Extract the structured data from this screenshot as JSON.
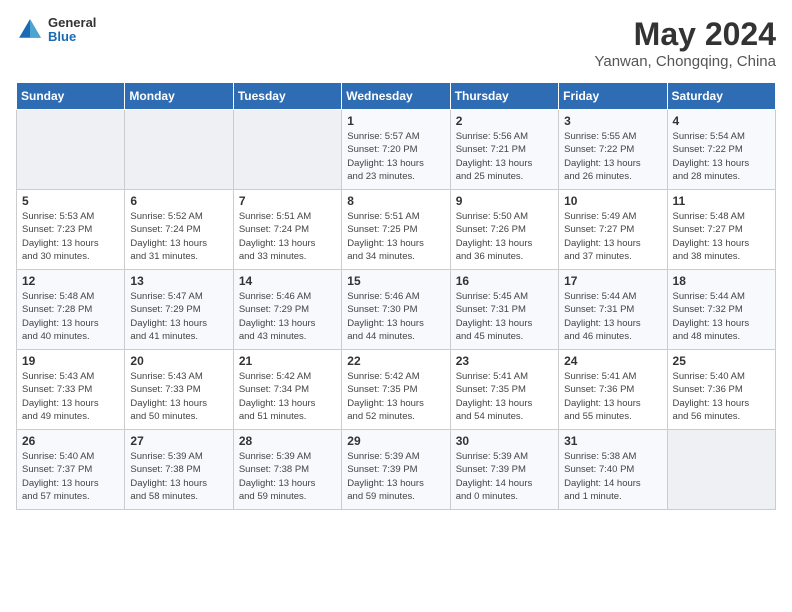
{
  "header": {
    "logo_general": "General",
    "logo_blue": "Blue",
    "title": "May 2024",
    "subtitle": "Yanwan, Chongqing, China"
  },
  "weekdays": [
    "Sunday",
    "Monday",
    "Tuesday",
    "Wednesday",
    "Thursday",
    "Friday",
    "Saturday"
  ],
  "weeks": [
    [
      {
        "day": "",
        "info": ""
      },
      {
        "day": "",
        "info": ""
      },
      {
        "day": "",
        "info": ""
      },
      {
        "day": "1",
        "info": "Sunrise: 5:57 AM\nSunset: 7:20 PM\nDaylight: 13 hours\nand 23 minutes."
      },
      {
        "day": "2",
        "info": "Sunrise: 5:56 AM\nSunset: 7:21 PM\nDaylight: 13 hours\nand 25 minutes."
      },
      {
        "day": "3",
        "info": "Sunrise: 5:55 AM\nSunset: 7:22 PM\nDaylight: 13 hours\nand 26 minutes."
      },
      {
        "day": "4",
        "info": "Sunrise: 5:54 AM\nSunset: 7:22 PM\nDaylight: 13 hours\nand 28 minutes."
      }
    ],
    [
      {
        "day": "5",
        "info": "Sunrise: 5:53 AM\nSunset: 7:23 PM\nDaylight: 13 hours\nand 30 minutes."
      },
      {
        "day": "6",
        "info": "Sunrise: 5:52 AM\nSunset: 7:24 PM\nDaylight: 13 hours\nand 31 minutes."
      },
      {
        "day": "7",
        "info": "Sunrise: 5:51 AM\nSunset: 7:24 PM\nDaylight: 13 hours\nand 33 minutes."
      },
      {
        "day": "8",
        "info": "Sunrise: 5:51 AM\nSunset: 7:25 PM\nDaylight: 13 hours\nand 34 minutes."
      },
      {
        "day": "9",
        "info": "Sunrise: 5:50 AM\nSunset: 7:26 PM\nDaylight: 13 hours\nand 36 minutes."
      },
      {
        "day": "10",
        "info": "Sunrise: 5:49 AM\nSunset: 7:27 PM\nDaylight: 13 hours\nand 37 minutes."
      },
      {
        "day": "11",
        "info": "Sunrise: 5:48 AM\nSunset: 7:27 PM\nDaylight: 13 hours\nand 38 minutes."
      }
    ],
    [
      {
        "day": "12",
        "info": "Sunrise: 5:48 AM\nSunset: 7:28 PM\nDaylight: 13 hours\nand 40 minutes."
      },
      {
        "day": "13",
        "info": "Sunrise: 5:47 AM\nSunset: 7:29 PM\nDaylight: 13 hours\nand 41 minutes."
      },
      {
        "day": "14",
        "info": "Sunrise: 5:46 AM\nSunset: 7:29 PM\nDaylight: 13 hours\nand 43 minutes."
      },
      {
        "day": "15",
        "info": "Sunrise: 5:46 AM\nSunset: 7:30 PM\nDaylight: 13 hours\nand 44 minutes."
      },
      {
        "day": "16",
        "info": "Sunrise: 5:45 AM\nSunset: 7:31 PM\nDaylight: 13 hours\nand 45 minutes."
      },
      {
        "day": "17",
        "info": "Sunrise: 5:44 AM\nSunset: 7:31 PM\nDaylight: 13 hours\nand 46 minutes."
      },
      {
        "day": "18",
        "info": "Sunrise: 5:44 AM\nSunset: 7:32 PM\nDaylight: 13 hours\nand 48 minutes."
      }
    ],
    [
      {
        "day": "19",
        "info": "Sunrise: 5:43 AM\nSunset: 7:33 PM\nDaylight: 13 hours\nand 49 minutes."
      },
      {
        "day": "20",
        "info": "Sunrise: 5:43 AM\nSunset: 7:33 PM\nDaylight: 13 hours\nand 50 minutes."
      },
      {
        "day": "21",
        "info": "Sunrise: 5:42 AM\nSunset: 7:34 PM\nDaylight: 13 hours\nand 51 minutes."
      },
      {
        "day": "22",
        "info": "Sunrise: 5:42 AM\nSunset: 7:35 PM\nDaylight: 13 hours\nand 52 minutes."
      },
      {
        "day": "23",
        "info": "Sunrise: 5:41 AM\nSunset: 7:35 PM\nDaylight: 13 hours\nand 54 minutes."
      },
      {
        "day": "24",
        "info": "Sunrise: 5:41 AM\nSunset: 7:36 PM\nDaylight: 13 hours\nand 55 minutes."
      },
      {
        "day": "25",
        "info": "Sunrise: 5:40 AM\nSunset: 7:36 PM\nDaylight: 13 hours\nand 56 minutes."
      }
    ],
    [
      {
        "day": "26",
        "info": "Sunrise: 5:40 AM\nSunset: 7:37 PM\nDaylight: 13 hours\nand 57 minutes."
      },
      {
        "day": "27",
        "info": "Sunrise: 5:39 AM\nSunset: 7:38 PM\nDaylight: 13 hours\nand 58 minutes."
      },
      {
        "day": "28",
        "info": "Sunrise: 5:39 AM\nSunset: 7:38 PM\nDaylight: 13 hours\nand 59 minutes."
      },
      {
        "day": "29",
        "info": "Sunrise: 5:39 AM\nSunset: 7:39 PM\nDaylight: 13 hours\nand 59 minutes."
      },
      {
        "day": "30",
        "info": "Sunrise: 5:39 AM\nSunset: 7:39 PM\nDaylight: 14 hours\nand 0 minutes."
      },
      {
        "day": "31",
        "info": "Sunrise: 5:38 AM\nSunset: 7:40 PM\nDaylight: 14 hours\nand 1 minute."
      },
      {
        "day": "",
        "info": ""
      }
    ]
  ]
}
